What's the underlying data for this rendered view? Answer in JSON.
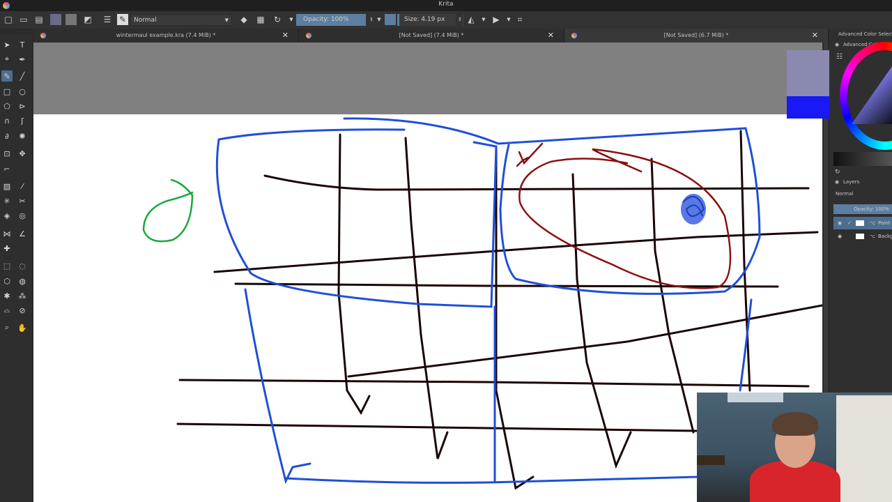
{
  "window": {
    "title": "Krita"
  },
  "toolbar": {
    "blend_mode": "Normal",
    "opacity_label": "Opacity: 100%",
    "opacity_value": 1.0,
    "size_label": "Size: 4.19 px"
  },
  "tabs": [
    {
      "label": "wintermaul example.kra (7.4 MiB) *"
    },
    {
      "label": "[Not Saved]  (7.4 MiB) *"
    },
    {
      "label": "[Not Saved]  (6.7 MiB) *"
    }
  ],
  "right_panel": {
    "docker_title": "Advanced Color Selector",
    "docker_subtitle": "Advanced Color Selector",
    "layers_title": "Layers",
    "layers_blend": "Normal",
    "layers_opacity": "Opacity: 100%",
    "layers": [
      {
        "name": "Paint Layer"
      },
      {
        "name": "Background"
      }
    ]
  },
  "colors": {
    "foreground": "#1919f5",
    "previous": "#8a8ab0",
    "accent": "#5c7ea0"
  }
}
